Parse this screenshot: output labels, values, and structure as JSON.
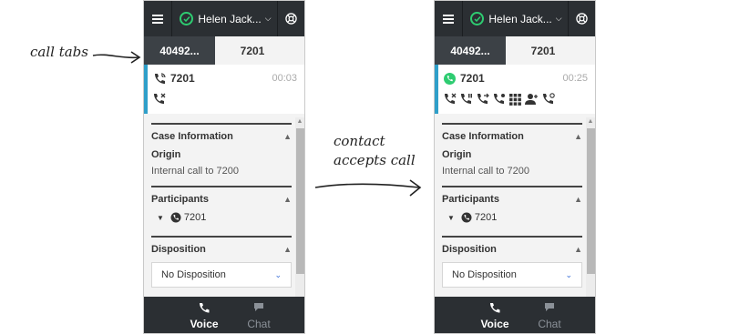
{
  "annotations": {
    "call_tabs": "call tabs",
    "contact_accepts_line1": "contact",
    "contact_accepts_line2": "accepts call"
  },
  "colors": {
    "topbar": "#2b2f33",
    "status_green": "#2ecc71",
    "accent_blue": "#2f9fc9",
    "connected_green": "#2ecc71"
  },
  "panel_left": {
    "user_name": "Helen Jack...",
    "tabs": [
      "40492...",
      "7201"
    ],
    "active_tab": "7201",
    "call_number": "7201",
    "call_timer": "00:03",
    "case_information": "Case Information",
    "origin_label": "Origin",
    "origin_value": "Internal call to 7200",
    "participants_title": "Participants",
    "participant": "7201",
    "disposition_title": "Disposition",
    "disposition_value": "No Disposition",
    "bottom_tabs": [
      "Voice",
      "Chat"
    ]
  },
  "panel_right": {
    "user_name": "Helen Jack...",
    "tabs": [
      "40492...",
      "7201"
    ],
    "active_tab": "7201",
    "call_number": "7201",
    "call_timer": "00:25",
    "case_information": "Case Information",
    "origin_label": "Origin",
    "origin_value": "Internal call to 7200",
    "participants_title": "Participants",
    "participant": "7201",
    "disposition_title": "Disposition",
    "disposition_value": "No Disposition",
    "bottom_tabs": [
      "Voice",
      "Chat"
    ]
  }
}
